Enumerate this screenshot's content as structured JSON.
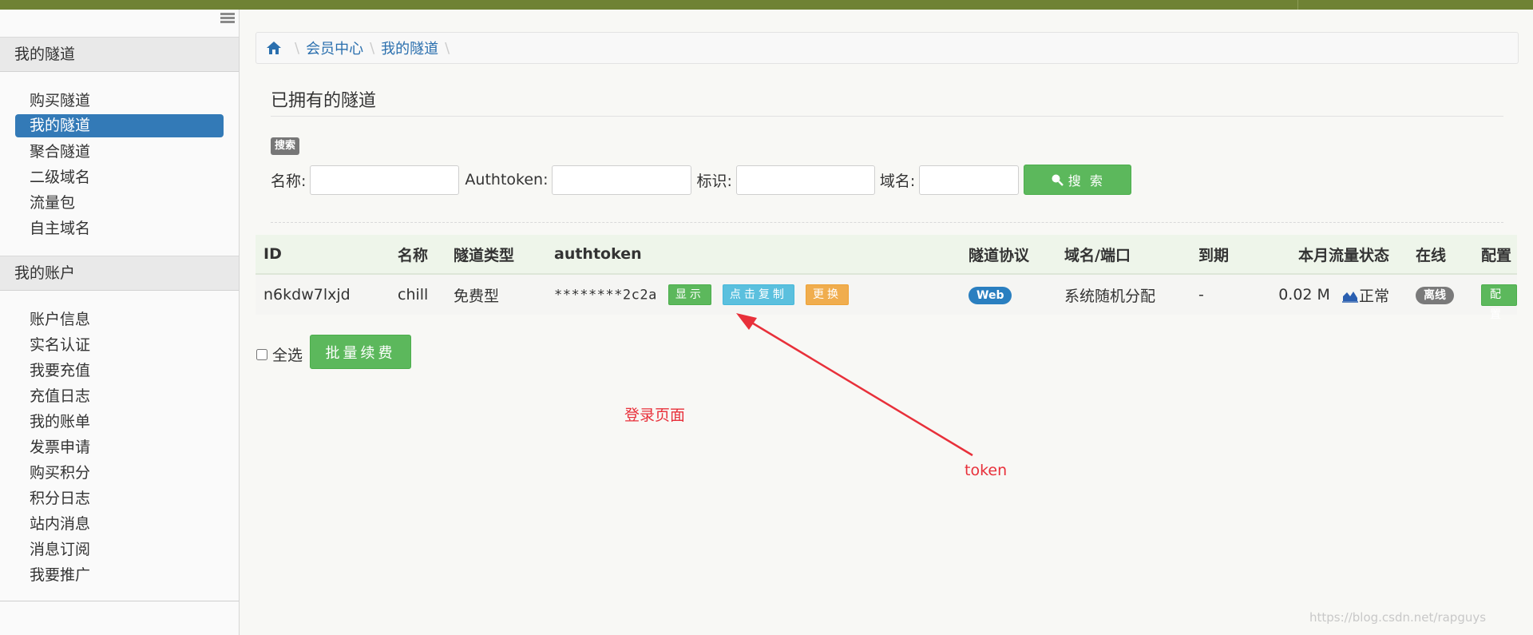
{
  "sidebar": {
    "section1_title": "我的隧道",
    "section1_items": [
      "购买隧道",
      "我的隧道",
      "聚合隧道",
      "二级域名",
      "流量包",
      "自主域名"
    ],
    "section2_title": "我的账户",
    "section2_items": [
      "账户信息",
      "实名认证",
      "我要充值",
      "充值日志",
      "我的账单",
      "发票申请",
      "购买积分",
      "积分日志",
      "站内消息",
      "消息订阅",
      "我要推广"
    ]
  },
  "breadcrumb": {
    "home_icon": "home-icon",
    "items": [
      "会员中心",
      "我的隧道"
    ]
  },
  "page_title": "已拥有的隧道",
  "search": {
    "badge": "搜索",
    "name_label": "名称:",
    "authtoken_label": "Authtoken:",
    "tag_label": "标识:",
    "domain_label": "域名:",
    "button": "搜 索"
  },
  "table": {
    "headers": [
      "ID",
      "名称",
      "隧道类型",
      "authtoken",
      "隧道协议",
      "域名/端口",
      "到期",
      "本月流量",
      "状态",
      "在线",
      "配置"
    ],
    "rows": [
      {
        "id": "n6kdw7lxjd",
        "name": "chill",
        "type": "免费型",
        "authtoken": "********2c2a",
        "btn_show": "显示",
        "btn_copy": "点击复制",
        "btn_change": "更换",
        "protocol": "Web",
        "domain": "系统随机分配",
        "expire": "-",
        "traffic": "0.02 M",
        "status": "正常",
        "online": "离线",
        "config": "配置"
      }
    ]
  },
  "footer": {
    "select_all": "全选",
    "renew_button": "批量续费"
  },
  "annotations": {
    "login": "登录页面",
    "token": "token"
  },
  "watermark": "https://blog.csdn.net/rapguys",
  "colors": {
    "accent": "#337ab7",
    "success": "#5cb85c",
    "info": "#5bc0de",
    "warning": "#f0ad4e",
    "annotation": "#e8303a",
    "topbar": "#6f8234"
  }
}
